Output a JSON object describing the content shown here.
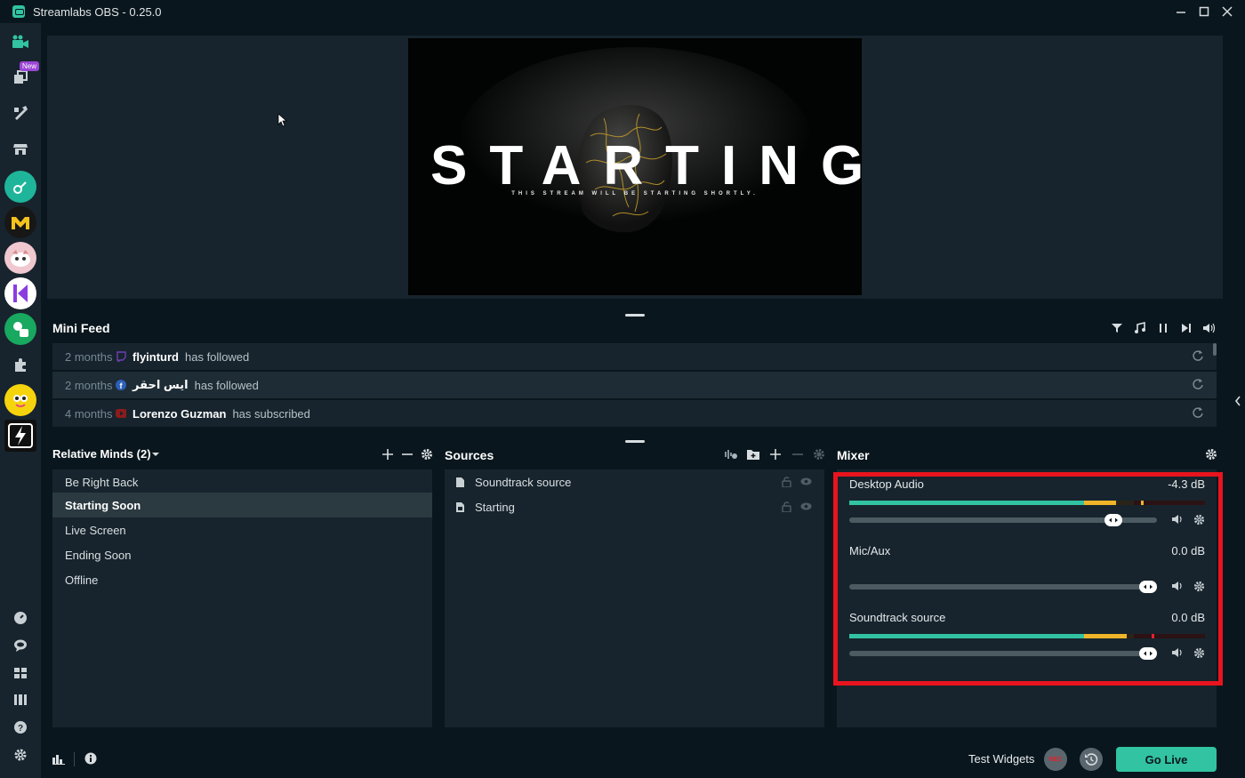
{
  "window": {
    "title": "Streamlabs OBS - 0.25.0"
  },
  "sidebar": {
    "new_badge": "New",
    "icons": [
      "studio-icon",
      "themes-icon",
      "editor-icon",
      "store-icon",
      "app-icon-1",
      "app-icon-2",
      "app-icon-3",
      "app-icon-4",
      "app-icon-5",
      "puzzle-icon",
      "app-icon-6",
      "app-icon-7",
      "dashboard-icon",
      "chat-icon",
      "layout-icon",
      "columns-icon",
      "help-icon",
      "settings-icon"
    ]
  },
  "preview": {
    "title_text": "STARTING",
    "subtitle_text": "THIS STREAM WILL BE STARTING SHORTLY."
  },
  "mini_feed": {
    "title": "Mini Feed",
    "events": [
      {
        "time": "2 months",
        "platform": "twitch",
        "name": "flyinturd",
        "action": "has followed"
      },
      {
        "time": "2 months",
        "platform": "facebook",
        "name": "ايس احقر",
        "action": "has followed"
      },
      {
        "time": "4 months",
        "platform": "youtube",
        "name": "Lorenzo Guzman",
        "action": "has subscribed"
      }
    ]
  },
  "scenes": {
    "title": "Relative Minds (2)",
    "items": [
      "Be Right Back",
      "Starting Soon",
      "Live Screen",
      "Ending Soon",
      "Offline"
    ],
    "active": "Starting Soon"
  },
  "sources": {
    "title": "Sources",
    "items": [
      "Soundtrack source",
      "Starting"
    ]
  },
  "mixer": {
    "title": "Mixer",
    "channels": [
      {
        "name": "Desktop Audio",
        "db": "-4.3 dB",
        "level": 0.75,
        "volume": 0.88
      },
      {
        "name": "Mic/Aux",
        "db": "0.0 dB",
        "level": 0.0,
        "volume": 1.0
      },
      {
        "name": "Soundtrack source",
        "db": "0.0 dB",
        "level": 0.78,
        "volume": 1.0
      }
    ]
  },
  "footer": {
    "test_widgets": "Test Widgets",
    "rec": "REC",
    "go_live": "Go Live"
  },
  "colors": {
    "accent": "#31c3a2",
    "background": "#09161d",
    "panel": "#17242d",
    "highlight": "#e8141e",
    "rec": "#e6202d"
  }
}
